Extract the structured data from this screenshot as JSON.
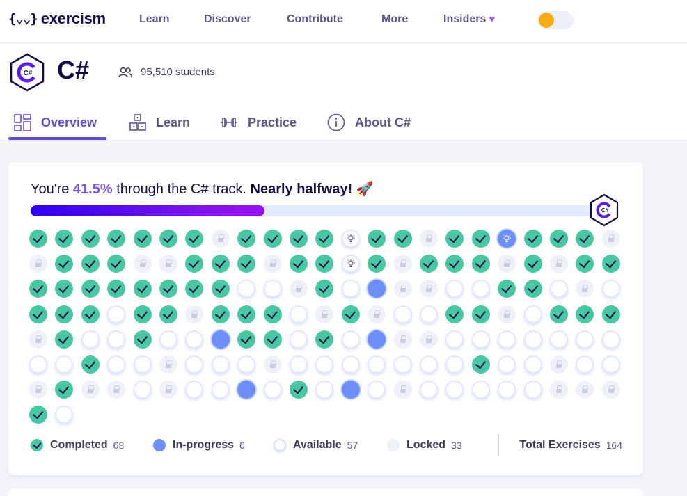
{
  "nav": {
    "logo_mark": "{⌄⌄}",
    "logo_text": "exercism",
    "links": [
      "Learn",
      "Discover",
      "Contribute",
      "More",
      "Insiders"
    ],
    "insiders_icon": "heart-icon",
    "theme_toggle_color": "#f6ac12"
  },
  "track": {
    "title": "C#",
    "icon_label": "C#",
    "students": "95,510 students",
    "tabs": [
      "Overview",
      "Learn",
      "Practice",
      "About C#"
    ],
    "active_tab": "Overview"
  },
  "progress": {
    "headline_prefix": "You're ",
    "percent": "41.5%",
    "headline_middle": " through the C# track. ",
    "headline_strong": "Nearly halfway!",
    "headline_emoji": "🚀",
    "fraction": 0.415,
    "exercises": [
      "C",
      "C",
      "C",
      "C",
      "C",
      "C",
      "C",
      "L",
      "C",
      "C",
      "C",
      "C",
      "B",
      "C",
      "C",
      "L",
      "C",
      "C",
      "BI",
      "C",
      "C",
      "C",
      "L",
      "L",
      "C",
      "C",
      "C",
      "L",
      "L",
      "C",
      "C",
      "C",
      "L",
      "C",
      "C",
      "B",
      "C",
      "L",
      "C",
      "C",
      "C",
      "L",
      "C",
      "L",
      "C",
      "C",
      "C",
      "C",
      "C",
      "C",
      "C",
      "C",
      "C",
      "C",
      "A",
      "A",
      "L",
      "C",
      "A",
      "I",
      "L",
      "L",
      "A",
      "A",
      "C",
      "C",
      "A",
      "L",
      "A",
      "C",
      "C",
      "C",
      "A",
      "C",
      "C",
      "L",
      "C",
      "C",
      "C",
      "A",
      "L",
      "C",
      "L",
      "A",
      "A",
      "C",
      "C",
      "L",
      "A",
      "C",
      "C",
      "C",
      "L",
      "C",
      "A",
      "A",
      "C",
      "A",
      "A",
      "I",
      "C",
      "C",
      "A",
      "C",
      "A",
      "I",
      "L",
      "L",
      "A",
      "A",
      "A",
      "A",
      "A",
      "A",
      "A",
      "A",
      "A",
      "C",
      "A",
      "A",
      "L",
      "A",
      "A",
      "A",
      "L",
      "A",
      "A",
      "A",
      "A",
      "A",
      "A",
      "A",
      "C",
      "A",
      "A",
      "L",
      "A",
      "A",
      "L",
      "C",
      "L",
      "L",
      "A",
      "L",
      "A",
      "A",
      "I",
      "A",
      "C",
      "A",
      "I",
      "A",
      "L",
      "A",
      "A",
      "A",
      "A",
      "A",
      "L",
      "L",
      "L",
      "C",
      "A"
    ],
    "legend": {
      "completed_label": "Completed",
      "completed_count": "68",
      "in_progress_label": "In-progress",
      "in_progress_count": "6",
      "available_label": "Available",
      "available_count": "57",
      "locked_label": "Locked",
      "locked_count": "33",
      "total_label": "Total Exercises",
      "total_count": "164"
    }
  },
  "colors": {
    "accent": "#604fcd",
    "completed": "#48c7a2",
    "in_progress": "#6d8ef6",
    "percent_text": "#7a56e8"
  }
}
